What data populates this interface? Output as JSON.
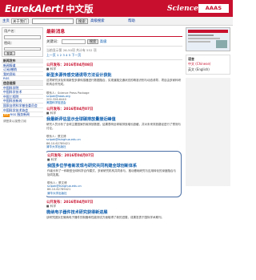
{
  "header": {
    "logo_en": "EurekAlert!",
    "logo_cn": "中文版",
    "science": "Science",
    "aaas": "AAAS"
  },
  "toolbar": {
    "home_label": "主页",
    "scope_select": "关于我们",
    "search_placeholder": "",
    "search_button": "搜索",
    "advanced_search": "高级搜索",
    "help": "帮助"
  },
  "sidebar": {
    "user_label": "用户名：",
    "password_label": "密码：",
    "login_button": "登录",
    "nav_items": [
      {
        "label": "新闻发布",
        "header": true
      },
      {
        "label": "新闻报道"
      },
      {
        "label": "订阅/撤销"
      },
      {
        "label": "我的资料"
      },
      {
        "label": "RSS"
      },
      {
        "label": "信息链接",
        "header": true
      },
      {
        "label": "中国科学院"
      },
      {
        "label": "中国科学技术"
      },
      {
        "label": "中国工程院"
      },
      {
        "label": "中国科技新闻"
      },
      {
        "label": "国家自然科学基金委员会"
      },
      {
        "label": "中国科学技术协会"
      },
      {
        "label": "RSS 服务新闻",
        "rss": true
      }
    ],
    "subscribe_text": "请登录以接受订阅"
  },
  "main": {
    "page_title": "最新消息",
    "search_label": "关键词：",
    "search_button": "搜索",
    "advanced": "高级",
    "result_note": "当前显示第 26-50项 共计有 552 项",
    "pager": "上一页  1  2  3  4  5  下一页",
    "items": [
      {
        "date": "公开发布：2016年04月08日",
        "tag": "■ 科学",
        "title": "新型多源传感交通诱导方法设计获批",
        "body": "这项研究涉及采用新型多源传感器进行数据融合，实现道路交通状态的精准识别与动态诱导，项目由多家科研机构合作完成。",
        "meta1": "联系人：Science Press Package",
        "meta2": "scipak@aaas.org",
        "meta3": "202-326-6440",
        "meta4": "美国科学促进会"
      },
      {
        "date": "公开发布：2016年04月07日",
        "tag": "■ 科学",
        "title": "我最新评估显示全球碳排放量接近峰值",
        "body": "研究人员分析了全球主要国家的碳排放数据，结果表明全球碳排放增长趋缓，并对未来排放路径进行了预测与讨论。",
        "meta1": "联系人：蔡文博",
        "meta2": "scipak@tsinghua.edu.cn",
        "meta3": "86-10-62789421",
        "meta4": "清华大学出版社"
      },
      {
        "date": "公开发布：2016年04月07日",
        "tag": "■ 科学",
        "title": "我国多位学者新发现与研究共同构建全球创新体系",
        "body": "作者分析了一种新型全球科学合作模式，多家研究机构共同参与，推动基础研究与应用转化的深度融合与协同发展。",
        "meta1": "联系人：蔡文博",
        "meta2": "scipak@tsinghua.edu.cn",
        "meta3": "86-10-62789421",
        "meta4": "清华大学出版社"
      },
      {
        "date": "公开发布：2016年04月07日",
        "tag": "■ 科学",
        "title": "微纳电子器件技术研究获得新进展",
        "body": "该研究团队在微纳电子器件的制备和性能测试方面取得了新的进展，成果发表于国际学术期刊。",
        "meta1": "",
        "meta2": "",
        "meta3": "",
        "meta4": ""
      }
    ]
  },
  "right": {
    "lang_header": "语言",
    "lang_options": [
      "中文 (Chinese)",
      "英文 (English)"
    ]
  }
}
